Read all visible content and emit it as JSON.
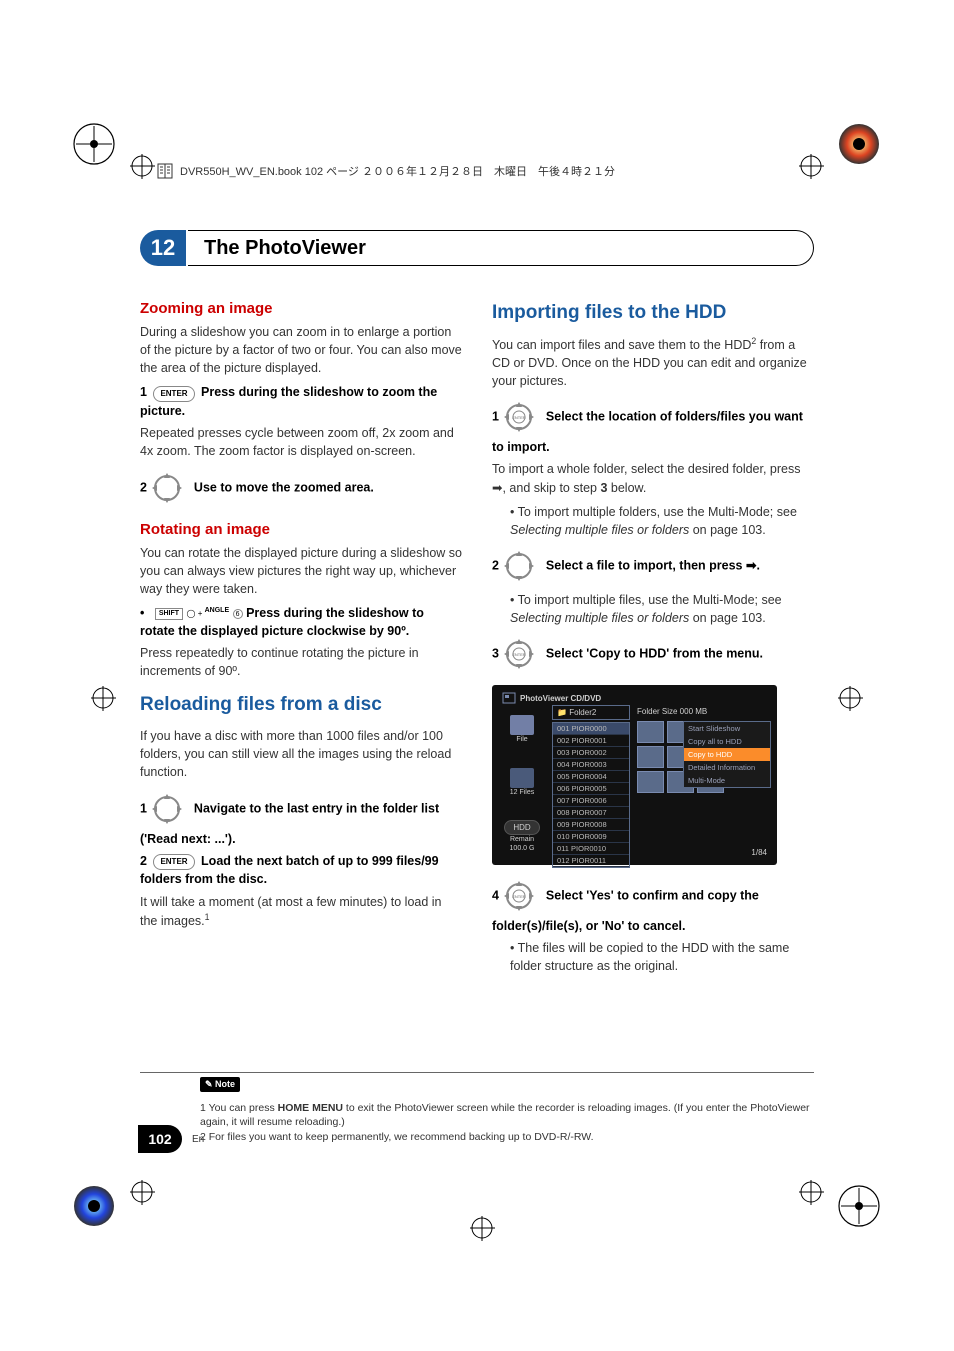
{
  "header": {
    "filename_text": "DVR550H_WV_EN.book 102 ページ ２００６年１２月２８日　木曜日　午後４時２１分"
  },
  "chapter": {
    "number": "12",
    "title": "The PhotoViewer"
  },
  "left": {
    "zoom_h": "Zooming an image",
    "zoom_p": "During a slideshow you can zoom in to enlarge a portion of the picture by a factor of two or four. You can also move the area of the picture displayed.",
    "step1_num": "1",
    "step1_btn": "ENTER",
    "step1_bold": "Press during the slideshow to zoom the picture.",
    "step1_body": "Repeated presses cycle between zoom off, 2x zoom and 4x zoom. The zoom factor is displayed on-screen.",
    "step2_num": "2",
    "step2_bold": "Use to move the zoomed area.",
    "rotate_h": "Rotating an image",
    "rotate_p": "You can rotate the displayed picture during a slideshow so you can always view pictures the right way up, whichever way they were taken.",
    "rot_bullet_shift": "SHIFT",
    "rot_bullet_angle": "ANGLE",
    "rot_bullet_bold": "Press during the slideshow to rotate the displayed picture clockwise by 90º.",
    "rot_bullet_body": "Press repeatedly to continue rotating the picture in increments of 90º.",
    "reload_h": "Reloading files from a disc",
    "reload_p": "If you have a disc with more than 1000 files and/or 100 folders, you can still view all the images using the reload function.",
    "rstep1_num": "1",
    "rstep1_bold": "Navigate to the last entry in the folder list ('Read next: ...').",
    "rstep2_num": "2",
    "rstep2_btn": "ENTER",
    "rstep2_bold": "Load the next batch of up to 999 files/99 folders from the disc.",
    "rstep2_body": "It will take a moment (at most a few minutes) to load in the images.",
    "rstep2_sup": "1"
  },
  "right": {
    "import_h": "Importing files to the HDD",
    "import_p1": "You can import files and save them to the HDD",
    "import_sup": "2",
    "import_p2": " from a CD or DVD. Once on the HDD you can edit and organize your pictures.",
    "istep1_num": "1",
    "istep1_btn": "ENTER",
    "istep1_bold": "Select the location of folders/files you want to import.",
    "istep1_body": "To import a whole folder, select the desired folder, press ",
    "istep1_body2": ", and skip to step ",
    "istep1_body3_num": "3",
    "istep1_body4": " below.",
    "istep1_bullet": "To import multiple folders, use the Multi-Mode; see ",
    "istep1_bullet_it": "Selecting multiple files or folders",
    "istep1_bullet2": " on page 103.",
    "istep2_num": "2",
    "istep2_bold": "Select a file to import, then press ",
    "istep2_arrow": ".",
    "istep2_bullet": "To import multiple files, use the Multi-Mode; see ",
    "istep2_bullet_it": "Selecting multiple files or folders",
    "istep2_bullet2": " on page 103.",
    "istep3_num": "3",
    "istep3_btn": "ENTER",
    "istep3_bold": "Select 'Copy to HDD' from the menu.",
    "istep4_num": "4",
    "istep4_btn": "ENTER",
    "istep4_bold": "Select 'Yes' to confirm and copy the folder(s)/file(s), or 'No' to cancel.",
    "istep4_bullet": "The files will be copied to the HDD with the same folder structure as the original."
  },
  "panel": {
    "title": "PhotoViewer  CD/DVD",
    "side_file": "File",
    "side_files": "12 Files",
    "side_hdd": "HDD",
    "side_remain": "Remain",
    "side_remain_val": "100.0 G",
    "folder": "Folder2",
    "folder_size": "Folder Size 000 MB",
    "items": [
      "001 PIOR0000",
      "002 PIOR0001",
      "003 PIOR0002",
      "004 PIOR0003",
      "005 PIOR0004",
      "006 PIOR0005",
      "007 PIOR0006",
      "008 PIOR0007",
      "009 PIOR0008",
      "010 PIOR0009",
      "011 PIOR0010",
      "012 PIOR0011"
    ],
    "menu": [
      "Start Slideshow",
      "Copy all to HDD",
      "Copy to HDD",
      "Detailed Information",
      "Multi-Mode"
    ],
    "paginator": "1/84"
  },
  "footnotes": {
    "note_label": "Note",
    "f1a": "1 You can press ",
    "f1_bold": "HOME MENU",
    "f1b": " to exit the PhotoViewer screen while the recorder is reloading images. (If you enter the PhotoViewer again, it will resume reloading.)",
    "f2": "2 For files you want to keep permanently, we recommend backing up to DVD-R/-RW."
  },
  "page": {
    "number": "102",
    "lang": "En"
  }
}
